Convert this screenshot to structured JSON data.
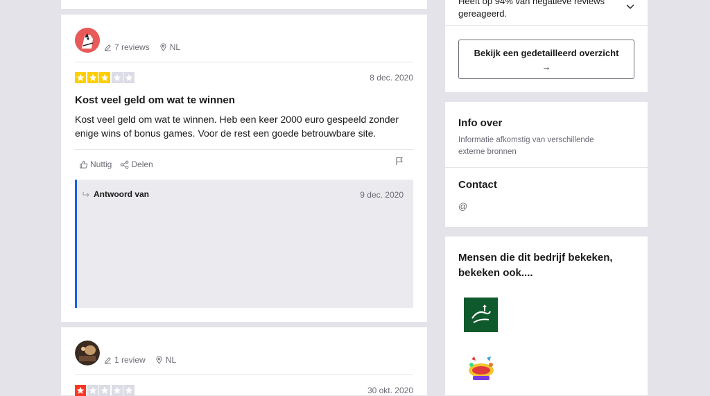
{
  "reviews": [
    {
      "reviewer_meta": {
        "count": "7 reviews",
        "country": "NL"
      },
      "rating": 3,
      "date": "8 dec. 2020",
      "title": "Kost veel geld om wat te winnen",
      "body_line1": "Kost veel geld om wat te winnen. Heb een keer 2000 euro gespeeld zonder",
      "body_line2": "enige wins of bonus games. Voor de rest een goede betrouwbare site.",
      "actions": {
        "useful": "Nuttig",
        "share": "Delen"
      },
      "reply": {
        "from": "Antwoord van",
        "date": "9 dec. 2020"
      }
    },
    {
      "reviewer_meta": {
        "count": "1 review",
        "country": "NL"
      },
      "rating": 1,
      "date": "30 okt. 2020"
    }
  ],
  "sidebar": {
    "response_line1": "Heeft op 94% van negatieve reviews",
    "response_line2": "gereageerd.",
    "overview_button_line1": "Bekijk een gedetailleerd overzicht",
    "overview_button_line2": "→",
    "info_title": "Info over",
    "info_sub_line1": "Informatie afkomstig van verschillende",
    "info_sub_line2": "externe bronnen",
    "contact_title": "Contact",
    "contact_email_icon": "@",
    "also_viewed_line1": "Mensen die dit bedrijf bekeken,",
    "also_viewed_line2": "bekeken ook...."
  },
  "colors": {
    "star_3": "#ffce00",
    "star_1": "#ff3722",
    "star_empty": "#dcdce6",
    "reply_accent": "#1c5ef0",
    "page_bg": "#e4e3ea"
  }
}
